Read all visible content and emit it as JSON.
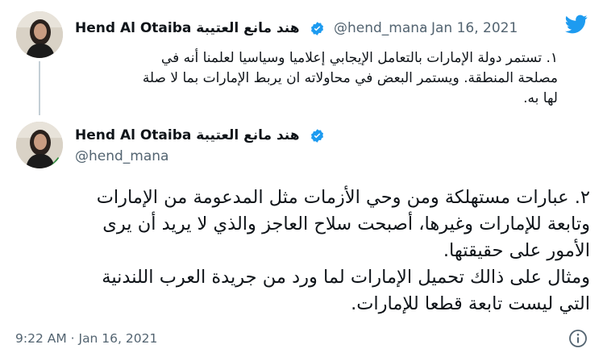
{
  "brand": {
    "logo": "twitter-bird-icon",
    "color": "#1d9bf0"
  },
  "tweet1": {
    "display_name": "Hend Al Otaiba هند مانع العتيبة",
    "handle": "@hend_mana",
    "separator": "·",
    "date": "Jan 16, 2021",
    "lines": [
      "١. تستمر دولة الإمارات بالتعامل الإيجابي إعلاميا وسياسيا لعلمنا أنه في",
      "مصلحة المنطقة. ويستمر البعض في محاولاته ان يربط الإمارات بما لا صلة",
      "لها به."
    ]
  },
  "tweet2": {
    "display_name": "Hend Al Otaiba هند مانع العتيبة",
    "handle": "@hend_mana",
    "lines": [
      "٢. عبارات مستهلكة ومن وحي الأزمات مثل المدعومة من الإمارات",
      "وتابعة للإمارات وغيرها، أصبحت سلاح العاجز والذي لا يريد أن يرى",
      "الأمور على حقيقتها.",
      "ومثال على ذالك  تحميل الإمارات لما ورد من جريدة العرب اللندنية",
      "التي ليست تابعة قطعا للإمارات."
    ],
    "timestamp": "9:22 AM · Jan 16, 2021",
    "info_icon": "info-icon"
  }
}
